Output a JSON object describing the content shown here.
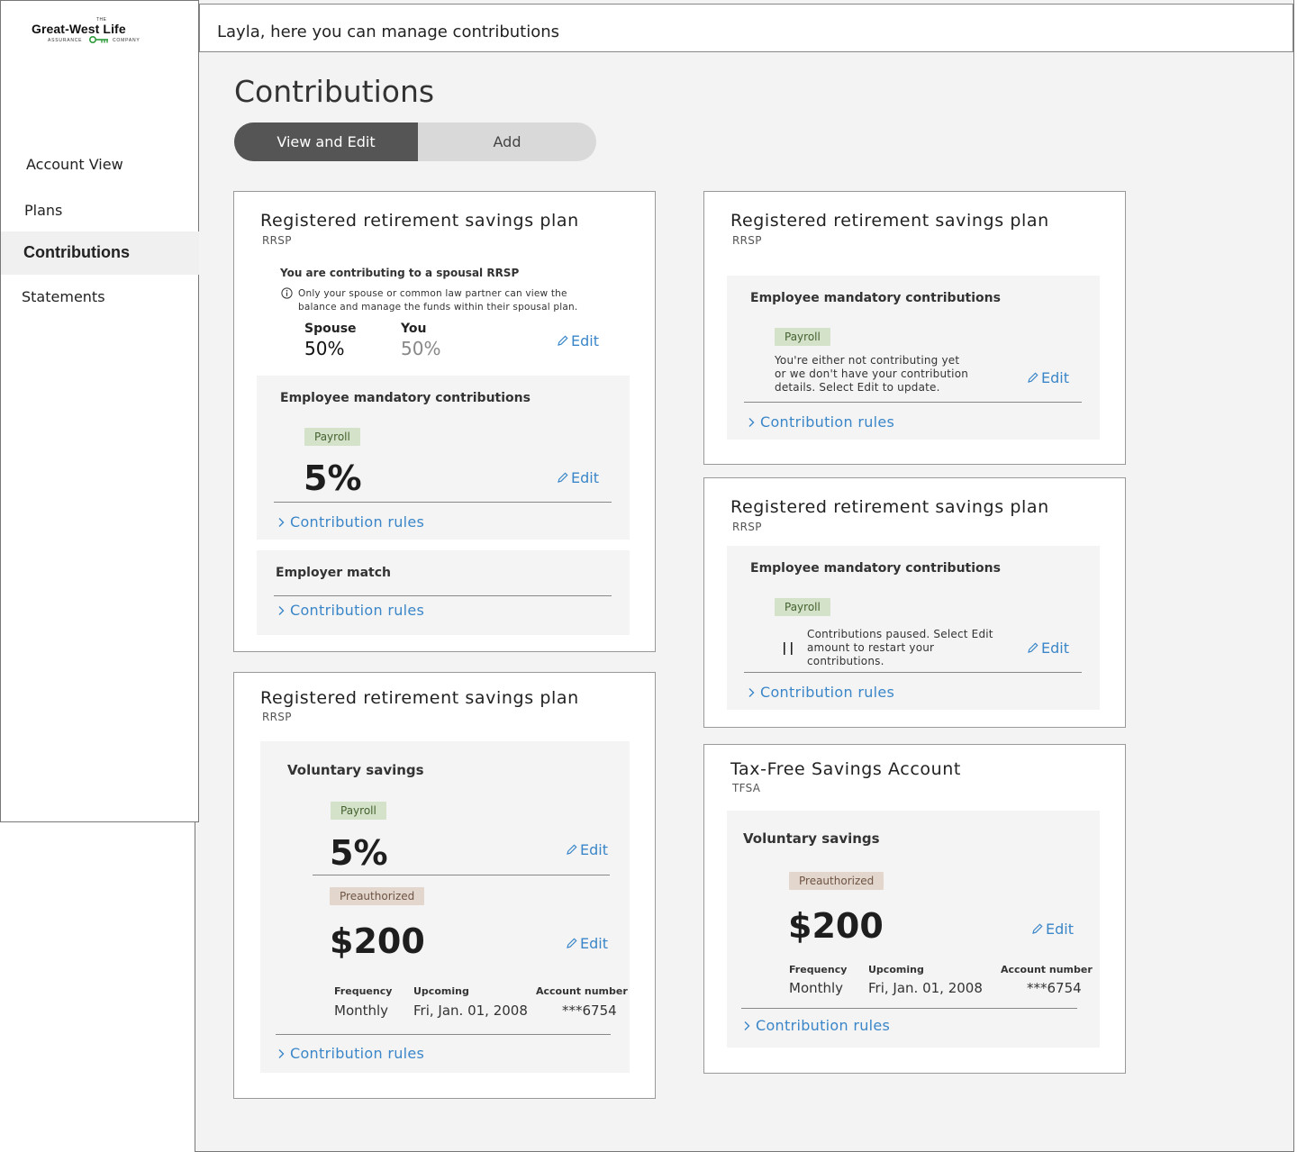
{
  "brand": {
    "the": "THE",
    "name": "Great-West Life",
    "assurance": "ASSURANCE",
    "company": "COMPANY"
  },
  "sidebar": {
    "items": [
      {
        "label": "Account View"
      },
      {
        "label": "Plans"
      },
      {
        "label": "Contributions"
      },
      {
        "label": "Statements"
      }
    ]
  },
  "header": {
    "greeting": "Layla, here you can manage contributions"
  },
  "page": {
    "title": "Contributions"
  },
  "tabs": {
    "view_edit": "View and Edit",
    "add": "Add"
  },
  "common": {
    "edit": "Edit",
    "rules": "Contribution rules"
  },
  "card1": {
    "title": "Registered retirement savings plan",
    "sub": "RRSP",
    "spousal_heading": "You are contributing to a spousal RRSP",
    "spousal_note_1": "Only your spouse or common law partner can view the",
    "spousal_note_2": "balance and manage the funds within their spousal plan.",
    "spouse_label": "Spouse",
    "spouse_value": "50%",
    "you_label": "You",
    "you_value": "50%",
    "mandatory_heading": "Employee mandatory contributions",
    "payroll_tag": "Payroll",
    "mandatory_value": "5%",
    "employer_heading": "Employer match"
  },
  "card2": {
    "title": "Registered retirement savings plan",
    "sub": "RRSP",
    "voluntary_heading": "Voluntary savings",
    "payroll_tag": "Payroll",
    "payroll_value": "5%",
    "preauth_tag": "Preauthorized",
    "preauth_value": "$200",
    "frequency_label": "Frequency",
    "frequency_value": "Monthly",
    "upcoming_label": "Upcoming",
    "upcoming_value": "Fri, Jan. 01, 2008",
    "account_label": "Account number",
    "account_value": "***6754"
  },
  "card3": {
    "title": "Registered retirement savings plan",
    "sub": "RRSP",
    "mandatory_heading": "Employee mandatory contributions",
    "payroll_tag": "Payroll",
    "note_1": "You're either not contributing yet",
    "note_2": "or we don't have your contribution",
    "note_3": "details. Select Edit to update."
  },
  "card4": {
    "title": "Registered retirement savings plan",
    "sub": "RRSP",
    "mandatory_heading": "Employee mandatory contributions",
    "payroll_tag": "Payroll",
    "note_1": "Contributions paused. Select Edit",
    "note_2": "amount to restart your",
    "note_3": "contributions."
  },
  "card5": {
    "title": "Tax-Free Savings Account",
    "sub": "TFSA",
    "voluntary_heading": "Voluntary savings",
    "preauth_tag": "Preauthorized",
    "preauth_value": "$200",
    "frequency_label": "Frequency",
    "frequency_value": "Monthly",
    "upcoming_label": "Upcoming",
    "upcoming_value": "Fri, Jan. 01, 2008",
    "account_label": "Account number",
    "account_value": "***6754"
  },
  "colors": {
    "accent": "#3a86c8",
    "tab_active": "#555555",
    "payroll_tag": "#d4e2c9",
    "preauth_tag": "#e3d6cc"
  }
}
